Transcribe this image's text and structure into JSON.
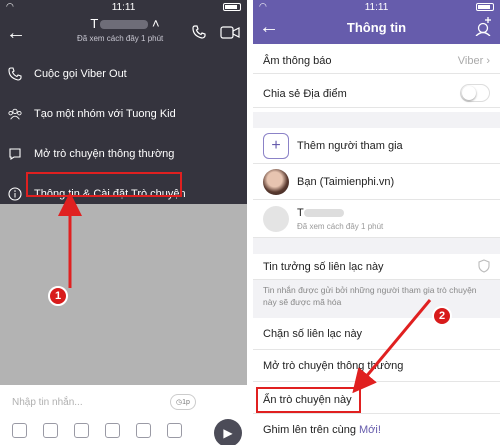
{
  "status_time_left": "11:11",
  "status_time_right": "11:11",
  "chat": {
    "name": "T",
    "last_seen": "Đã xem cách đây 1 phút",
    "menu": [
      {
        "label": "Cuộc gọi Viber Out",
        "icon": "phone-out-icon"
      },
      {
        "label": "Tạo một nhóm với Tuong Kid",
        "icon": "group-icon"
      },
      {
        "label": "Mở trò chuyện thông thường",
        "icon": "chat-bubble-icon"
      },
      {
        "label": "Thông tin & Cài đặt Trò chuyện",
        "icon": "info-icon"
      }
    ],
    "input_placeholder": "Nhập tin nhắn...",
    "timer_label": "1p",
    "badge": "1"
  },
  "info": {
    "title": "Thông tin",
    "notification_label": "Âm thông báo",
    "notification_value": "Viber",
    "share_location_label": "Chia sẻ Địa điểm",
    "add_participant_label": "Thêm người tham gia",
    "participant_1": "Bạn (Taimienphi.vn)",
    "participant_2_initial": "T",
    "participant_2_sub": "Đã xem cách đây 1 phút",
    "trust_contact_label": "Tin tưởng số liên lạc này",
    "encryption_note": "Tin nhắn được gửi bởi những người tham gia trò chuyện này sẽ được mã hóa",
    "block_contact_label": "Chặn số liên lạc này",
    "open_regular_chat_label": "Mở trò chuyện thông thường",
    "hide_chat_label": "Ẩn trò chuyện này",
    "pin_label": "Ghim lên trên cùng",
    "pin_new": "Mới!",
    "badge": "2"
  },
  "colors": {
    "viber_purple": "#665cac",
    "dark_bar": "#35343e",
    "highlight_red": "#e02020"
  }
}
